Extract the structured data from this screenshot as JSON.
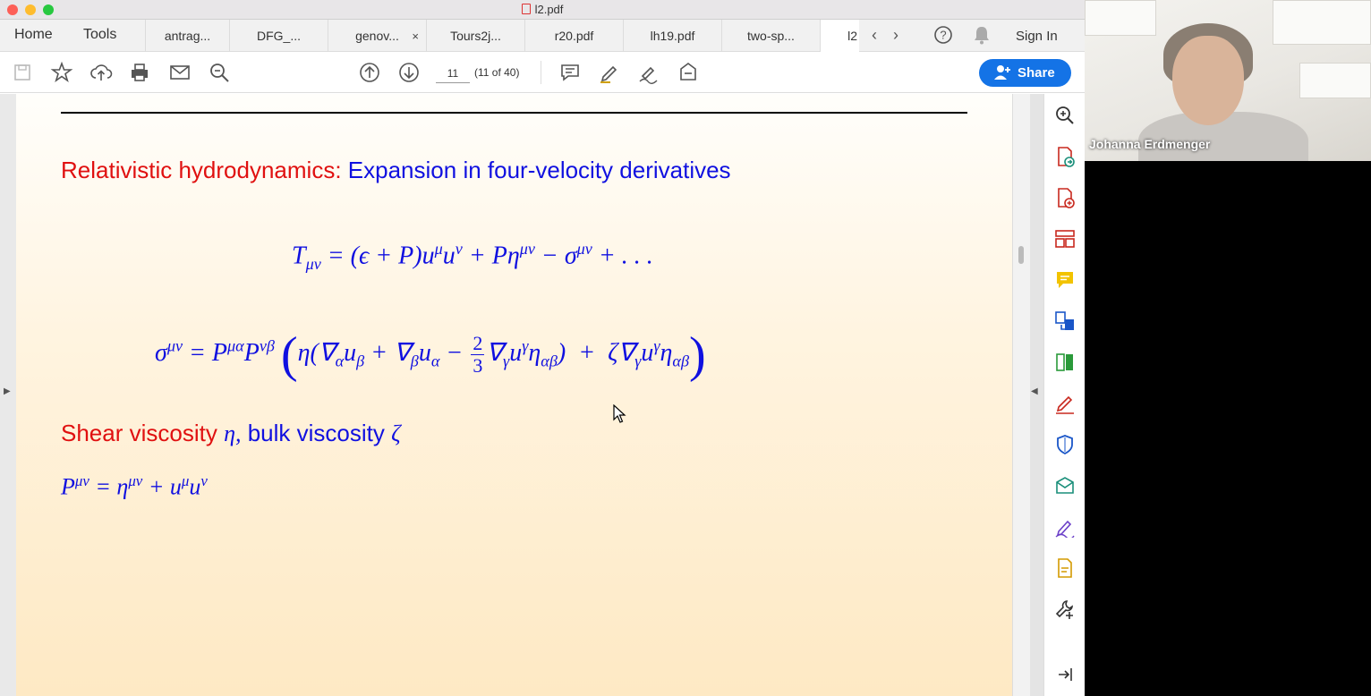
{
  "window": {
    "title": "l2.pdf"
  },
  "nav": {
    "home": "Home",
    "tools": "Tools"
  },
  "tabs": [
    {
      "label": "antrag..."
    },
    {
      "label": "DFG_..."
    },
    {
      "label": "genov...",
      "close": "×"
    },
    {
      "label": "Tours2j..."
    },
    {
      "label": "r20.pdf"
    },
    {
      "label": "lh19.pdf"
    },
    {
      "label": "two-sp..."
    },
    {
      "label": "l2"
    }
  ],
  "header": {
    "signin": "Sign In",
    "share": "Share"
  },
  "toolbar": {
    "page_number": "11",
    "page_count": "(11 of 40)"
  },
  "slide": {
    "heading_red": "Relativistic hydrodynamics:",
    "heading_blue": "Expansion in four-velocity derivatives",
    "shear_red": "Shear viscosity",
    "eta": "η,",
    "bulk_blue": "bulk viscosity",
    "zeta": "ζ"
  },
  "webcam": {
    "participant_name": "Johanna Erdmenger"
  },
  "icons": {
    "toolbar": [
      "save-icon",
      "bookmark-star-icon",
      "upload-icon",
      "print-icon",
      "email-icon",
      "zoom-search-icon",
      "page-up-icon",
      "page-down-icon",
      "comment-icon",
      "highlight-pen-icon",
      "sign-icon",
      "stamp-icon"
    ],
    "right_panel": [
      "zoom-icon",
      "export-pdf-icon",
      "create-pdf-icon",
      "organize-pages-icon",
      "comment-icon",
      "combine-files-icon",
      "compare-icon",
      "fill-sign-icon",
      "protect-icon",
      "send-for-signature-icon",
      "edit-pdf-icon",
      "more-tools-icon",
      "tools-icon",
      "collapse-panel-icon"
    ]
  },
  "colors": {
    "accent": "#1473e6",
    "slide_red": "#e01010",
    "slide_blue": "#1010e0"
  }
}
